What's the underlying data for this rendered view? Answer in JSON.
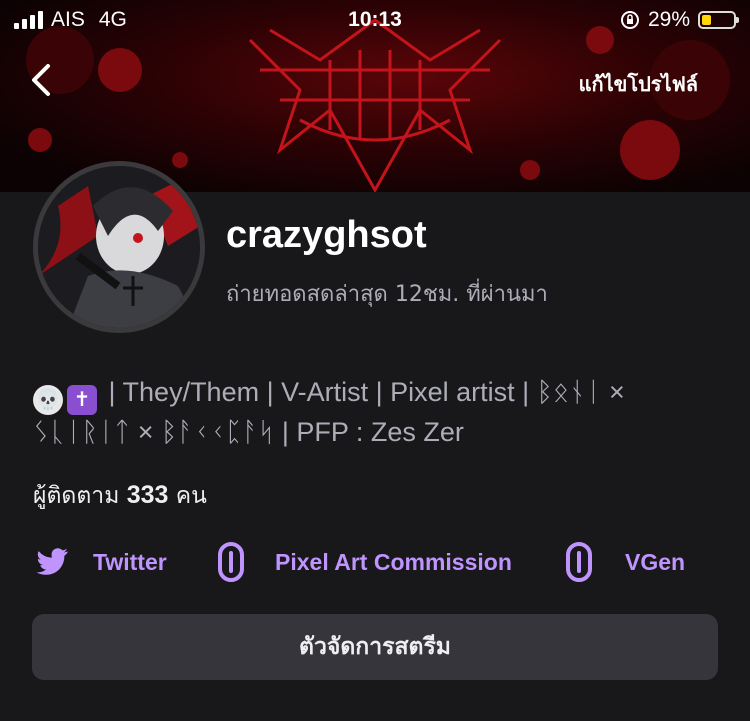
{
  "status_bar": {
    "carrier": "AIS",
    "network": "4G",
    "time": "10:13",
    "battery_percent": "29%",
    "battery_level": 0.29,
    "battery_color": "#ffd60a"
  },
  "header": {
    "edit_profile_label": "แก้ไขโปรไฟล์"
  },
  "profile": {
    "username": "crazyghsot",
    "last_stream": "ถ่ายทอดสดล่าสุด 12ชม. ที่ผ่านมา",
    "bio_emojis": [
      "💀",
      "✝"
    ],
    "bio_line1": "| They/Them | V-Artist | Pixel artist | ᛒᛟᚾᛁ ×",
    "bio_line2": "ᛊᚳᛁᚱᛁᛏ × ᛒᚨᚲᚲᛈᚨᛋ | PFP : Zes Zer",
    "followers_prefix": "ผู้ติดตาม",
    "followers_count": "333",
    "followers_suffix": "คน"
  },
  "links": [
    {
      "label": "Twitter",
      "icon": "twitter-bird-icon"
    },
    {
      "label": "Pixel Art Commission",
      "icon": "link-icon"
    },
    {
      "label": "VGen",
      "icon": "link-icon"
    }
  ],
  "actions": {
    "manage_stream_label": "ตัวจัดการสตรีม"
  },
  "colors": {
    "accent": "#bf94ff",
    "background": "#18181b",
    "banner_red": "#c3141b"
  }
}
